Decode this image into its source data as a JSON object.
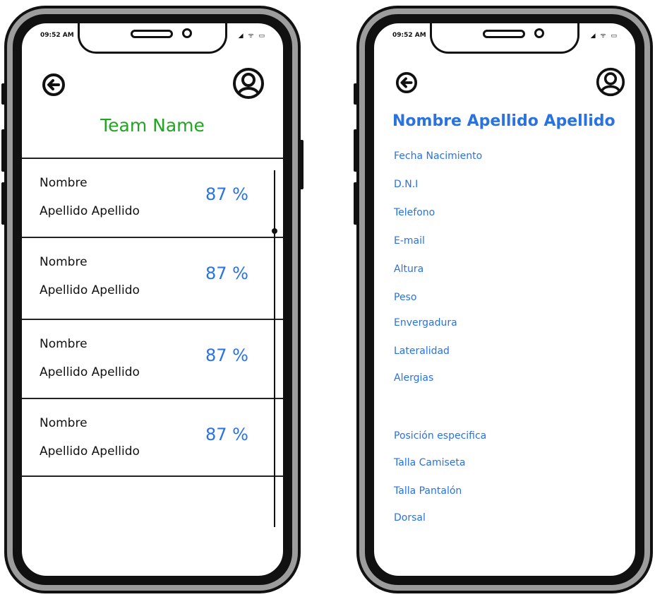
{
  "left_screen": {
    "status_time": "09:52 AM",
    "team_name": "Team Name",
    "players": [
      {
        "first": "Nombre",
        "last": "Apellido Apellido",
        "pct": "87 %"
      },
      {
        "first": "Nombre",
        "last": "Apellido Apellido",
        "pct": "87 %"
      },
      {
        "first": "Nombre",
        "last": "Apellido Apellido",
        "pct": "87 %"
      },
      {
        "first": "Nombre",
        "last": "Apellido Apellido",
        "pct": "87 %"
      }
    ]
  },
  "right_screen": {
    "status_time": "09:52 AM",
    "full_name": "Nombre Apellido Apellido",
    "fields": [
      "Fecha Nacimiento",
      "D.N.I",
      "Telefono",
      "E-mail",
      "Altura",
      "Peso",
      "Envergadura",
      "Lateralidad",
      "Alergias",
      "Posición especifica",
      "Talla Camiseta",
      "Talla Pantalón",
      "Dorsal"
    ]
  },
  "icons": {
    "back": "back-arrow-icon",
    "profile": "user-avatar-icon",
    "status": "signal-wifi-battery-icons"
  },
  "colors": {
    "team_name": "#22a522",
    "accent_blue": "#2a72e0",
    "frame_gray": "#9d9d9d"
  }
}
